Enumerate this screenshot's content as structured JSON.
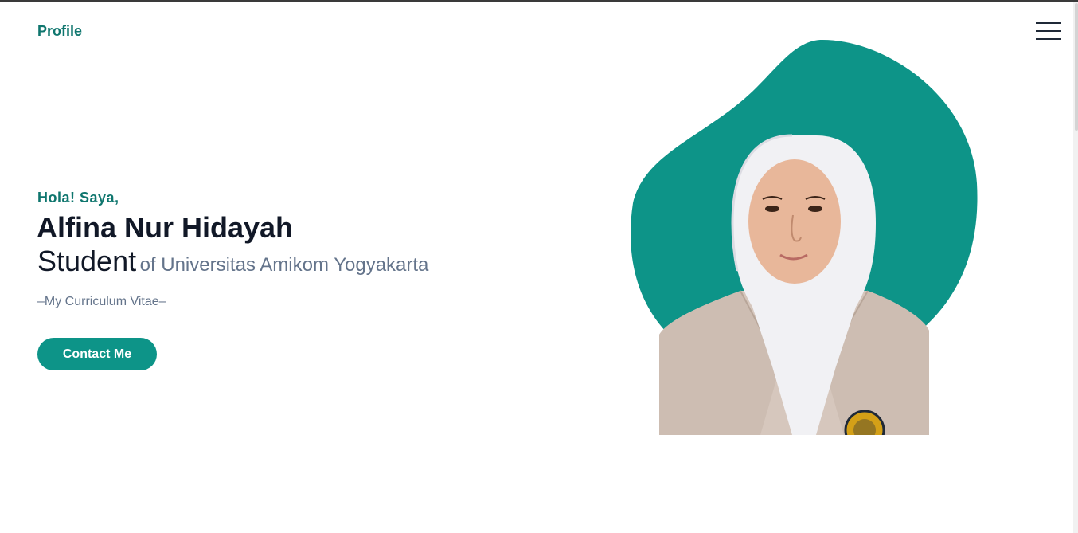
{
  "header": {
    "brand": "Profile",
    "menu_icon": "hamburger-menu-icon"
  },
  "hero": {
    "greeting": "Hola! Saya,",
    "name": "Alfina Nur Hidayah",
    "role": "Student",
    "institution": "of Universitas Amikom Yogyakarta",
    "caption": "–My Curriculum Vitae–",
    "contact_button": "Contact Me",
    "portrait": "profile-portrait"
  },
  "colors": {
    "accent": "#0d9488",
    "brand_text": "#0f766e",
    "heading": "#111827",
    "muted": "#64748b"
  }
}
